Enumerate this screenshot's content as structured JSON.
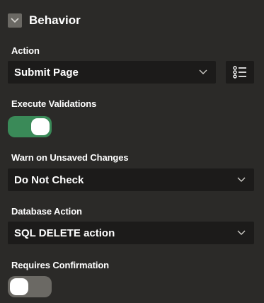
{
  "section": {
    "title": "Behavior",
    "toggle_icon": "chevron-down-icon"
  },
  "fields": {
    "action": {
      "label": "Action",
      "value": "Submit Page",
      "icon": "list-icon"
    },
    "execute_validations": {
      "label": "Execute Validations",
      "checked": true
    },
    "warn_unsaved": {
      "label": "Warn on Unsaved Changes",
      "value": "Do Not Check"
    },
    "database_action": {
      "label": "Database Action",
      "value": "SQL DELETE action"
    },
    "requires_confirmation": {
      "label": "Requires Confirmation",
      "checked": false
    }
  },
  "colors": {
    "background": "#2b2a28",
    "field_background": "#1c1b1a",
    "switch_on": "#3a8a58",
    "switch_off": "#6b6964"
  }
}
